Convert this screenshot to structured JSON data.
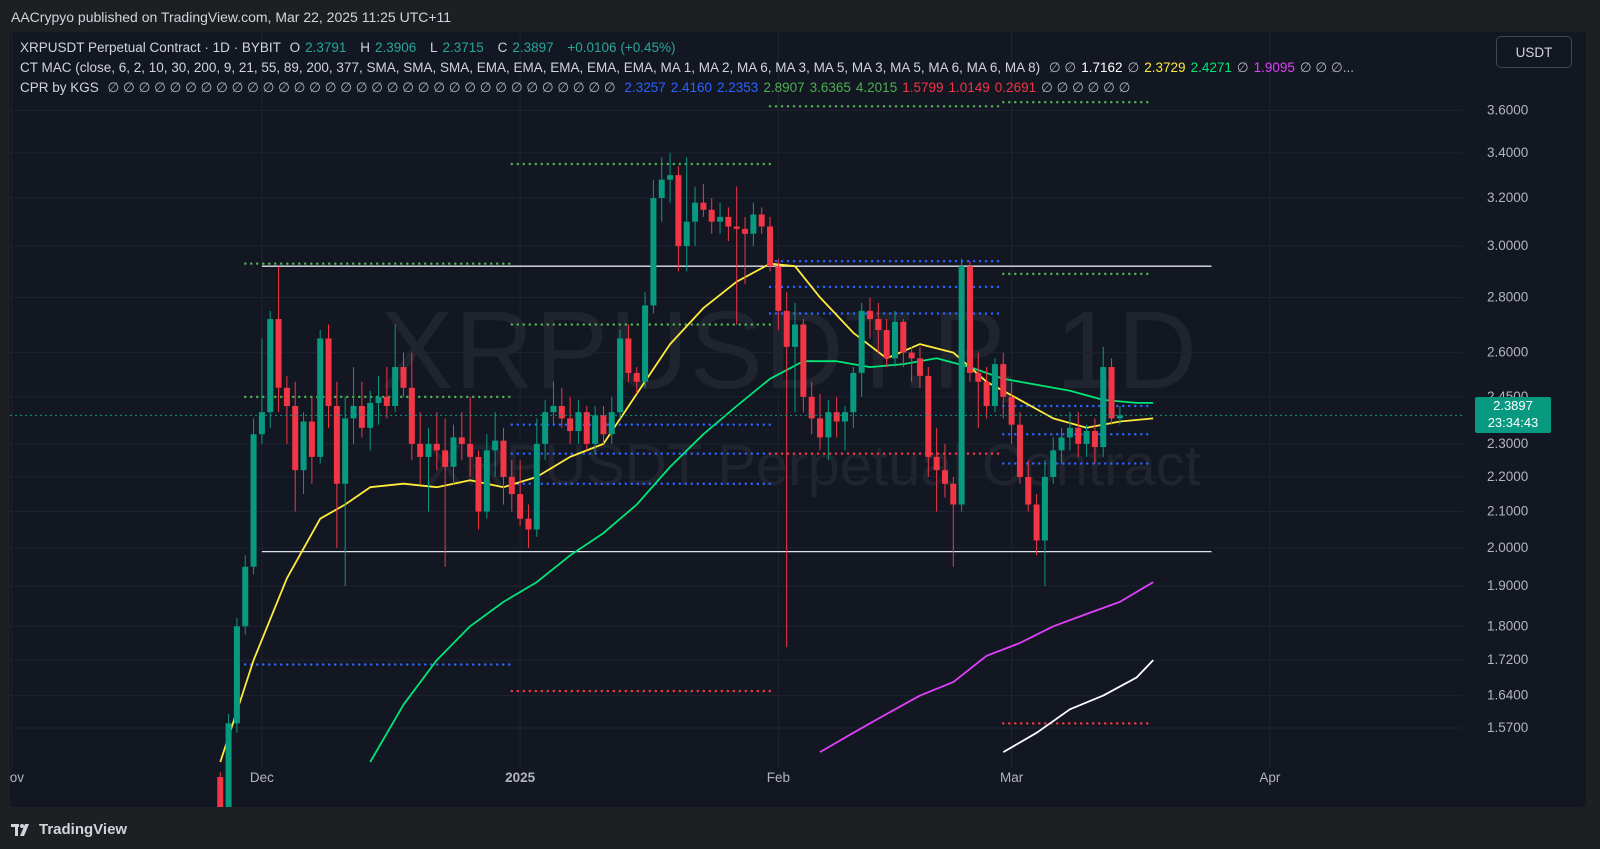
{
  "header": {
    "published": "AACrypyo published on TradingView.com, Mar 22, 2025 11:25 UTC+11"
  },
  "legend": {
    "symbol_line": "XRPUSDT Perpetual Contract · 1D · BYBIT",
    "o_label": "O",
    "o_value": "2.3791",
    "h_label": "H",
    "h_value": "2.3906",
    "l_label": "L",
    "l_value": "2.3715",
    "c_label": "C",
    "c_value": "2.3897",
    "change": "+0.0106 (+0.45%)",
    "mac_title": "CT MAC (close, 6, 2, 10, 30, 200, 9, 21, 55, 89, 200, 377, SMA, SMA, SMA, EMA, EMA, EMA, EMA, EMA, MA 1, MA 2, MA 6, MA 3, MA 5, MA 3, MA 5, MA 6, MA 6, MA 8)",
    "mac_values": [
      {
        "text": "∅ ∅",
        "color": "#b2b5be"
      },
      {
        "text": "1.7162",
        "color": "#ffffff"
      },
      {
        "text": "∅",
        "color": "#b2b5be"
      },
      {
        "text": "2.3729",
        "color": "#ffeb3b"
      },
      {
        "text": "2.4271",
        "color": "#00e676"
      },
      {
        "text": "∅",
        "color": "#b2b5be"
      },
      {
        "text": "1.9095",
        "color": "#e040fb"
      },
      {
        "text": "∅ ∅ ∅...",
        "color": "#b2b5be"
      }
    ],
    "cpr_title": "CPR by KGS",
    "cpr_nulls": "∅ ∅ ∅ ∅ ∅ ∅ ∅ ∅ ∅ ∅ ∅ ∅ ∅ ∅ ∅ ∅ ∅ ∅ ∅ ∅ ∅ ∅ ∅ ∅ ∅ ∅ ∅ ∅ ∅ ∅ ∅ ∅ ∅",
    "cpr_values": [
      {
        "text": "2.3257",
        "color": "#2962ff"
      },
      {
        "text": "2.4160",
        "color": "#2962ff"
      },
      {
        "text": "2.2353",
        "color": "#2962ff"
      },
      {
        "text": "2.8907",
        "color": "#4caf50"
      },
      {
        "text": "3.6365",
        "color": "#4caf50"
      },
      {
        "text": "4.2015",
        "color": "#4caf50"
      },
      {
        "text": "1.5799",
        "color": "#f23645"
      },
      {
        "text": "1.0149",
        "color": "#f23645"
      },
      {
        "text": "0.2691",
        "color": "#f23645"
      },
      {
        "text": "∅ ∅ ∅ ∅ ∅ ∅",
        "color": "#b2b5be"
      }
    ]
  },
  "currency_button": "USDT",
  "watermark": {
    "symbol": "XRPUSDT.P, 1D",
    "name": "XRPUSDT Perpetual Contract"
  },
  "last_price": {
    "value": "2.3897",
    "countdown": "23:34:43"
  },
  "footer": {
    "brand": "TradingView"
  },
  "colors": {
    "up": "#089981",
    "down": "#f23645",
    "ma_yellow": "#ffeb3b",
    "ma_green": "#00e676",
    "ma_magenta": "#e040fb",
    "ma_white": "#ffffff",
    "cpr_green": "#4caf50",
    "cpr_blue": "#2962ff",
    "cpr_red": "#f23645"
  },
  "chart_data": {
    "type": "candlestick",
    "symbol": "XRPUSDT Perpetual Contract",
    "interval": "1D",
    "scale": "log",
    "ylim": [
      1.5,
      3.75
    ],
    "y_ticks": [
      "1.5700",
      "1.6400",
      "1.7200",
      "1.8000",
      "1.9000",
      "2.0000",
      "2.1000",
      "2.2000",
      "2.3000",
      "2.4500",
      "2.6000",
      "2.8000",
      "3.0000",
      "3.2000",
      "3.4000",
      "3.6000"
    ],
    "x_ticks": [
      {
        "label": "Nov",
        "date": "2024-11-01"
      },
      {
        "label": "Dec",
        "date": "2024-12-01"
      },
      {
        "label": "2025",
        "date": "2025-01-01"
      },
      {
        "label": "Feb",
        "date": "2025-02-01"
      },
      {
        "label": "Mar",
        "date": "2025-03-01"
      },
      {
        "label": "Apr",
        "date": "2025-04-01"
      }
    ],
    "first_candle_date": "2024-11-26",
    "candles_ohlc": [
      [
        1.47,
        1.48,
        1.3,
        1.36
      ],
      [
        1.36,
        1.6,
        1.36,
        1.58
      ],
      [
        1.58,
        1.82,
        1.56,
        1.8
      ],
      [
        1.8,
        1.98,
        1.78,
        1.95
      ],
      [
        1.95,
        2.38,
        1.93,
        2.33
      ],
      [
        2.33,
        2.65,
        2.3,
        2.4
      ],
      [
        2.4,
        2.75,
        2.35,
        2.72
      ],
      [
        2.72,
        2.92,
        2.4,
        2.48
      ],
      [
        2.48,
        2.52,
        2.3,
        2.42
      ],
      [
        2.42,
        2.5,
        2.1,
        2.22
      ],
      [
        2.22,
        2.4,
        2.15,
        2.37
      ],
      [
        2.37,
        2.45,
        2.18,
        2.26
      ],
      [
        2.26,
        2.68,
        2.24,
        2.65
      ],
      [
        2.65,
        2.7,
        2.35,
        2.42
      ],
      [
        2.42,
        2.5,
        2.0,
        2.18
      ],
      [
        2.18,
        2.45,
        1.9,
        2.38
      ],
      [
        2.38,
        2.55,
        2.3,
        2.42
      ],
      [
        2.42,
        2.5,
        2.32,
        2.35
      ],
      [
        2.35,
        2.47,
        2.28,
        2.43
      ],
      [
        2.43,
        2.52,
        2.36,
        2.45
      ],
      [
        2.45,
        2.55,
        2.38,
        2.42
      ],
      [
        2.42,
        2.7,
        2.4,
        2.55
      ],
      [
        2.55,
        2.6,
        2.45,
        2.48
      ],
      [
        2.48,
        2.6,
        2.25,
        2.3
      ],
      [
        2.3,
        2.4,
        2.18,
        2.26
      ],
      [
        2.26,
        2.35,
        2.1,
        2.3
      ],
      [
        2.3,
        2.4,
        2.22,
        2.28
      ],
      [
        2.28,
        2.38,
        1.95,
        2.23
      ],
      [
        2.23,
        2.36,
        2.18,
        2.32
      ],
      [
        2.32,
        2.4,
        2.25,
        2.3
      ],
      [
        2.3,
        2.45,
        2.2,
        2.26
      ],
      [
        2.26,
        2.28,
        2.05,
        2.1
      ],
      [
        2.1,
        2.33,
        2.08,
        2.28
      ],
      [
        2.28,
        2.4,
        2.2,
        2.31
      ],
      [
        2.31,
        2.35,
        2.12,
        2.2
      ],
      [
        2.2,
        2.25,
        2.1,
        2.15
      ],
      [
        2.15,
        2.25,
        2.06,
        2.08
      ],
      [
        2.08,
        2.12,
        2.0,
        2.05
      ],
      [
        2.05,
        2.38,
        2.03,
        2.3
      ],
      [
        2.3,
        2.44,
        2.25,
        2.4
      ],
      [
        2.4,
        2.5,
        2.36,
        2.42
      ],
      [
        2.42,
        2.48,
        2.35,
        2.38
      ],
      [
        2.38,
        2.45,
        2.3,
        2.34
      ],
      [
        2.34,
        2.44,
        2.3,
        2.4
      ],
      [
        2.4,
        2.42,
        2.28,
        2.3
      ],
      [
        2.3,
        2.42,
        2.27,
        2.39
      ],
      [
        2.39,
        2.42,
        2.3,
        2.33
      ],
      [
        2.33,
        2.45,
        2.3,
        2.4
      ],
      [
        2.4,
        2.68,
        2.38,
        2.65
      ],
      [
        2.65,
        2.7,
        2.5,
        2.53
      ],
      [
        2.53,
        2.55,
        2.46,
        2.5
      ],
      [
        2.5,
        2.82,
        2.48,
        2.77
      ],
      [
        2.77,
        3.28,
        2.74,
        3.2
      ],
      [
        3.2,
        3.38,
        3.1,
        3.28
      ],
      [
        3.28,
        3.4,
        3.18,
        3.3
      ],
      [
        3.3,
        3.34,
        2.9,
        3.0
      ],
      [
        3.0,
        3.38,
        2.9,
        3.1
      ],
      [
        3.1,
        3.25,
        3.0,
        3.18
      ],
      [
        3.18,
        3.26,
        3.12,
        3.15
      ],
      [
        3.15,
        3.2,
        3.05,
        3.1
      ],
      [
        3.1,
        3.18,
        3.05,
        3.12
      ],
      [
        3.12,
        3.16,
        3.02,
        3.08
      ],
      [
        3.08,
        3.25,
        2.7,
        3.07
      ],
      [
        3.07,
        3.12,
        2.85,
        3.05
      ],
      [
        3.05,
        3.18,
        3.0,
        3.13
      ],
      [
        3.13,
        3.16,
        3.05,
        3.08
      ],
      [
        3.08,
        3.12,
        2.9,
        2.92
      ],
      [
        2.92,
        2.95,
        2.68,
        2.75
      ],
      [
        2.75,
        2.82,
        1.75,
        2.62
      ],
      [
        2.62,
        2.78,
        2.4,
        2.7
      ],
      [
        2.7,
        2.72,
        2.4,
        2.45
      ],
      [
        2.45,
        2.5,
        2.33,
        2.38
      ],
      [
        2.38,
        2.46,
        2.28,
        2.32
      ],
      [
        2.32,
        2.44,
        2.25,
        2.4
      ],
      [
        2.4,
        2.45,
        2.32,
        2.37
      ],
      [
        2.37,
        2.42,
        2.28,
        2.4
      ],
      [
        2.4,
        2.55,
        2.35,
        2.53
      ],
      [
        2.53,
        2.78,
        2.45,
        2.75
      ],
      [
        2.75,
        2.8,
        2.65,
        2.72
      ],
      [
        2.72,
        2.78,
        2.6,
        2.68
      ],
      [
        2.68,
        2.72,
        2.55,
        2.58
      ],
      [
        2.58,
        2.75,
        2.55,
        2.71
      ],
      [
        2.71,
        2.72,
        2.55,
        2.6
      ],
      [
        2.6,
        2.62,
        2.5,
        2.58
      ],
      [
        2.58,
        2.62,
        2.48,
        2.52
      ],
      [
        2.52,
        2.55,
        2.2,
        2.26
      ],
      [
        2.26,
        2.35,
        2.1,
        2.22
      ],
      [
        2.22,
        2.3,
        2.14,
        2.18
      ],
      [
        2.18,
        2.2,
        1.95,
        2.12
      ],
      [
        2.12,
        2.95,
        2.1,
        2.92
      ],
      [
        2.92,
        2.94,
        2.5,
        2.53
      ],
      [
        2.53,
        2.6,
        2.35,
        2.5
      ],
      [
        2.5,
        2.55,
        2.38,
        2.42
      ],
      [
        2.42,
        2.58,
        2.4,
        2.56
      ],
      [
        2.56,
        2.6,
        2.38,
        2.45
      ],
      [
        2.45,
        2.5,
        2.3,
        2.36
      ],
      [
        2.36,
        2.4,
        2.18,
        2.2
      ],
      [
        2.2,
        2.25,
        2.1,
        2.12
      ],
      [
        2.12,
        2.15,
        1.98,
        2.02
      ],
      [
        2.02,
        2.25,
        1.9,
        2.2
      ],
      [
        2.2,
        2.32,
        2.18,
        2.28
      ],
      [
        2.28,
        2.35,
        2.24,
        2.32
      ],
      [
        2.32,
        2.4,
        2.28,
        2.35
      ],
      [
        2.35,
        2.4,
        2.26,
        2.3
      ],
      [
        2.3,
        2.36,
        2.26,
        2.34
      ],
      [
        2.34,
        2.38,
        2.24,
        2.29
      ],
      [
        2.29,
        2.62,
        2.26,
        2.55
      ],
      [
        2.55,
        2.58,
        2.36,
        2.38
      ],
      [
        2.38,
        2.42,
        2.36,
        2.39
      ]
    ],
    "moving_averages": [
      {
        "color": "#ffeb3b",
        "values": [
          [
            0,
            1.5
          ],
          [
            4,
            1.72
          ],
          [
            8,
            1.92
          ],
          [
            12,
            2.08
          ],
          [
            15,
            2.12
          ],
          [
            18,
            2.17
          ],
          [
            22,
            2.18
          ],
          [
            26,
            2.17
          ],
          [
            30,
            2.19
          ],
          [
            34,
            2.17
          ],
          [
            38,
            2.2
          ],
          [
            42,
            2.26
          ],
          [
            46,
            2.3
          ],
          [
            50,
            2.46
          ],
          [
            54,
            2.63
          ],
          [
            58,
            2.76
          ],
          [
            62,
            2.86
          ],
          [
            66,
            2.93
          ],
          [
            69,
            2.92
          ],
          [
            72,
            2.8
          ],
          [
            76,
            2.67
          ],
          [
            80,
            2.58
          ],
          [
            84,
            2.63
          ],
          [
            88,
            2.6
          ],
          [
            92,
            2.5
          ],
          [
            96,
            2.44
          ],
          [
            100,
            2.38
          ],
          [
            104,
            2.35
          ],
          [
            108,
            2.37
          ],
          [
            112,
            2.38
          ]
        ]
      },
      {
        "color": "#00e676",
        "values": [
          [
            18,
            1.5
          ],
          [
            22,
            1.62
          ],
          [
            26,
            1.72
          ],
          [
            30,
            1.8
          ],
          [
            34,
            1.86
          ],
          [
            38,
            1.91
          ],
          [
            42,
            1.98
          ],
          [
            46,
            2.04
          ],
          [
            50,
            2.12
          ],
          [
            54,
            2.23
          ],
          [
            58,
            2.33
          ],
          [
            62,
            2.42
          ],
          [
            66,
            2.51
          ],
          [
            70,
            2.57
          ],
          [
            74,
            2.57
          ],
          [
            78,
            2.55
          ],
          [
            82,
            2.56
          ],
          [
            86,
            2.58
          ],
          [
            90,
            2.55
          ],
          [
            94,
            2.51
          ],
          [
            98,
            2.49
          ],
          [
            102,
            2.47
          ],
          [
            106,
            2.44
          ],
          [
            110,
            2.43
          ],
          [
            112,
            2.43
          ]
        ]
      },
      {
        "color": "#e040fb",
        "values": [
          [
            72,
            1.52
          ],
          [
            76,
            1.56
          ],
          [
            80,
            1.6
          ],
          [
            84,
            1.64
          ],
          [
            88,
            1.67
          ],
          [
            92,
            1.73
          ],
          [
            96,
            1.76
          ],
          [
            100,
            1.8
          ],
          [
            104,
            1.83
          ],
          [
            108,
            1.86
          ],
          [
            112,
            1.91
          ]
        ]
      },
      {
        "color": "#ffffff",
        "values": [
          [
            94,
            1.52
          ],
          [
            98,
            1.56
          ],
          [
            102,
            1.61
          ],
          [
            106,
            1.64
          ],
          [
            110,
            1.68
          ],
          [
            112,
            1.72
          ]
        ]
      }
    ],
    "cpr_levels": [
      {
        "color": "#4caf50",
        "range": [
          3,
          35
        ],
        "values": [
          2.93,
          2.45
        ]
      },
      {
        "color": "#2962ff",
        "range": [
          3,
          35
        ],
        "values": [
          1.71
        ]
      },
      {
        "color": "#4caf50",
        "range": [
          35,
          66
        ],
        "values": [
          3.35,
          2.7
        ]
      },
      {
        "color": "#2962ff",
        "range": [
          35,
          66
        ],
        "values": [
          2.36,
          2.27,
          2.18
        ]
      },
      {
        "color": "#f23645",
        "range": [
          35,
          66
        ],
        "values": [
          1.65
        ]
      },
      {
        "color": "#2962ff",
        "range": [
          66,
          94
        ],
        "values": [
          2.94,
          2.84,
          2.74
        ]
      },
      {
        "color": "#f23645",
        "range": [
          66,
          94
        ],
        "values": [
          2.27
        ]
      },
      {
        "color": "#4caf50",
        "range": [
          66,
          94
        ],
        "values": [
          3.62
        ]
      },
      {
        "color": "#4caf50",
        "range": [
          94,
          112
        ],
        "values": [
          3.64,
          2.89
        ]
      },
      {
        "color": "#2962ff",
        "range": [
          94,
          112
        ],
        "values": [
          2.42,
          2.33,
          2.24
        ]
      },
      {
        "color": "#f23645",
        "range": [
          94,
          112
        ],
        "values": [
          1.58
        ]
      }
    ],
    "horizontal_lines": [
      {
        "value": 2.92,
        "from": 5,
        "to": 119
      },
      {
        "value": 1.99,
        "from": 5,
        "to": 119
      }
    ]
  }
}
